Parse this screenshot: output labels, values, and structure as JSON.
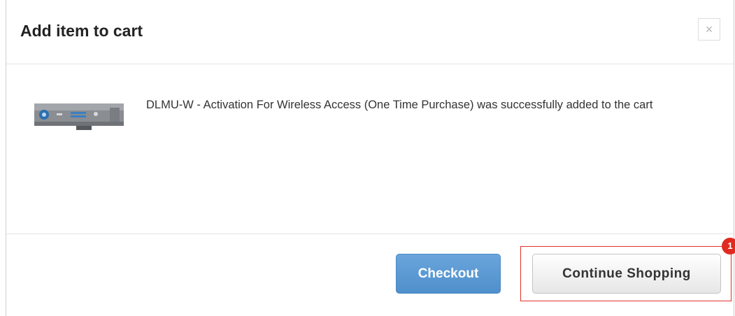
{
  "modal": {
    "title": "Add item to cart",
    "close_glyph": "×",
    "close_icon": "close-icon"
  },
  "product": {
    "image_icon": "wireless-adapter-image",
    "message": "DLMU-W - Activation For Wireless Access (One Time Purchase) was successfully added to the cart"
  },
  "footer": {
    "checkout_label": "Checkout",
    "continue_label": "Continue Shopping"
  },
  "annotation": {
    "step_number": "1",
    "highlight_color": "#e0312b",
    "badge_color": "#e02a20"
  },
  "colors": {
    "checkout_button": "#5b9bd5",
    "text": "#333333"
  }
}
